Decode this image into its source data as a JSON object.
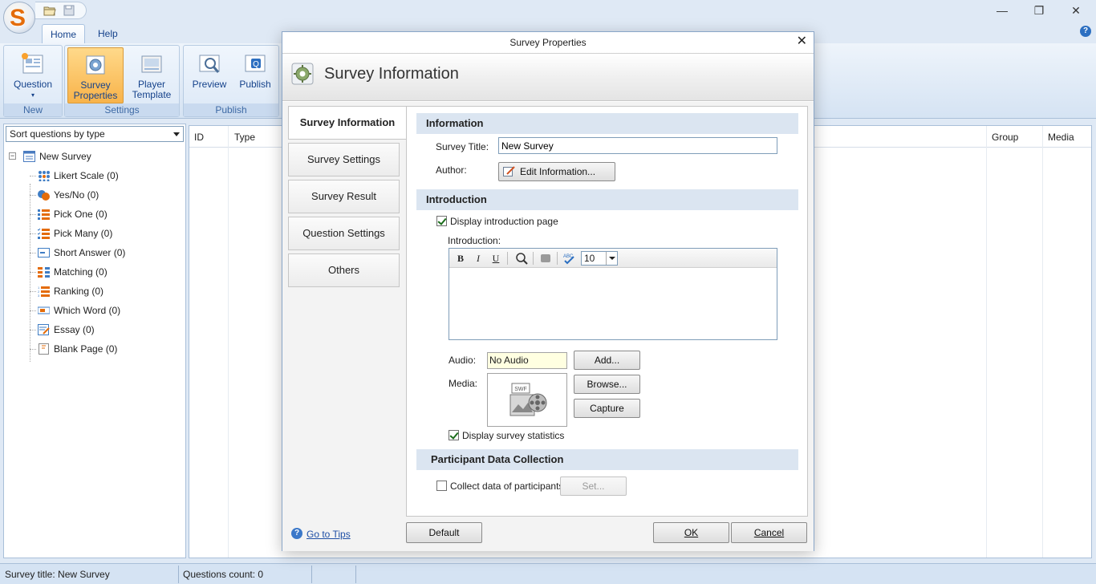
{
  "app": {
    "logo_letter": "S",
    "window_controls": {
      "minimize": "—",
      "restore": "❐",
      "close": "✕"
    }
  },
  "ribbon": {
    "tabs": [
      {
        "label": "Home",
        "active": true
      },
      {
        "label": "Help",
        "active": false
      }
    ],
    "groups": [
      {
        "label": "New",
        "buttons": [
          {
            "label": "Question",
            "has_dropdown": true
          }
        ]
      },
      {
        "label": "Settings",
        "buttons": [
          {
            "label": "Survey\nProperties",
            "active": true
          },
          {
            "label": "Player\nTemplate"
          }
        ]
      },
      {
        "label": "Publish",
        "buttons": [
          {
            "label": "Preview"
          },
          {
            "label": "Publish"
          }
        ]
      }
    ],
    "help_icon": "?"
  },
  "left_panel": {
    "sort_select": "Sort questions by type",
    "tree": {
      "root": "New Survey",
      "items": [
        {
          "label": "Likert Scale  (0)",
          "icon": "likert-scale-icon"
        },
        {
          "label": "Yes/No  (0)",
          "icon": "yes-no-icon"
        },
        {
          "label": "Pick One  (0)",
          "icon": "pick-one-icon"
        },
        {
          "label": "Pick Many  (0)",
          "icon": "pick-many-icon"
        },
        {
          "label": "Short Answer  (0)",
          "icon": "short-answer-icon"
        },
        {
          "label": "Matching  (0)",
          "icon": "matching-icon"
        },
        {
          "label": "Ranking  (0)",
          "icon": "ranking-icon"
        },
        {
          "label": "Which Word  (0)",
          "icon": "which-word-icon"
        },
        {
          "label": "Essay  (0)",
          "icon": "essay-icon"
        },
        {
          "label": "Blank Page  (0)",
          "icon": "blank-page-icon"
        }
      ]
    }
  },
  "grid": {
    "columns": [
      "ID",
      "Type",
      "Group",
      "Media"
    ]
  },
  "status_bar": {
    "survey_title": "Survey title: New Survey",
    "questions_count": "Questions count: 0"
  },
  "dialog": {
    "title": "Survey Properties",
    "header_title": "Survey Information",
    "side_tabs": [
      {
        "label": "Survey Information",
        "active": true
      },
      {
        "label": "Survey Settings"
      },
      {
        "label": "Survey Result"
      },
      {
        "label": "Question Settings"
      },
      {
        "label": "Others"
      }
    ],
    "information": {
      "section": "Information",
      "survey_title_label": "Survey Title:",
      "survey_title_value": "New Survey",
      "author_label": "Author:",
      "edit_info_button": "Edit Information..."
    },
    "introduction": {
      "section": "Introduction",
      "display_intro_label": "Display introduction page",
      "display_intro_checked": true,
      "intro_label": "Introduction:",
      "toolbar": {
        "bold": "B",
        "italic": "I",
        "underline": "U",
        "font_size": "10"
      },
      "audio_label": "Audio:",
      "audio_value": "No Audio",
      "add_button": "Add...",
      "media_label": "Media:",
      "browse_button": "Browse...",
      "capture_button": "Capture",
      "display_stats_label": "Display survey statistics",
      "display_stats_checked": true
    },
    "participant": {
      "section": "Participant Data Collection",
      "collect_label": "Collect data of participants",
      "collect_checked": false,
      "set_button": "Set..."
    },
    "footer": {
      "tips_link": "Go to Tips",
      "default_button": "Default",
      "ok_button": "OK",
      "cancel_button": "Cancel"
    }
  }
}
